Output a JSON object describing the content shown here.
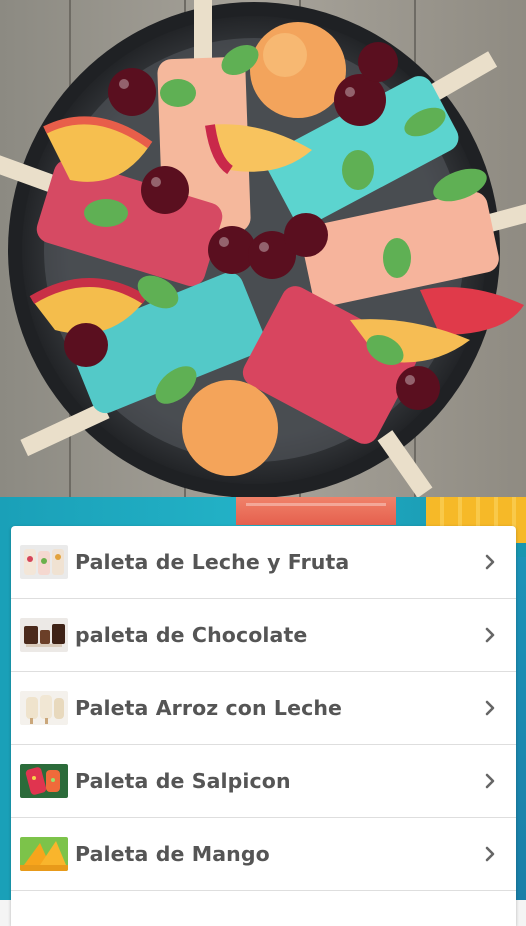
{
  "hero": {
    "image": "popsicles-on-tray-photo"
  },
  "recipes": [
    {
      "label": "Paleta de Leche y Fruta",
      "icon": "fruit-milk-popsicle-thumbnail"
    },
    {
      "label": "paleta de Chocolate",
      "icon": "chocolate-popsicle-thumbnail"
    },
    {
      "label": "Paleta Arroz con Leche",
      "icon": "rice-pudding-popsicle-thumbnail"
    },
    {
      "label": "Paleta de Salpicon",
      "icon": "salpicon-popsicle-thumbnail"
    },
    {
      "label": "Paleta de Mango",
      "icon": "mango-popsicle-thumbnail"
    }
  ],
  "colors": {
    "accent": "#22b1c6",
    "text": "#555555",
    "chevron": "#666666"
  }
}
